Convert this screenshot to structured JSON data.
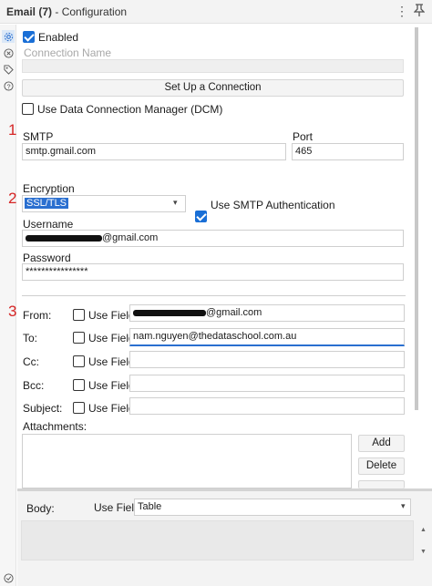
{
  "header": {
    "tool": "Email (7)",
    "title": "- Configuration",
    "more_icon": "kebab-icon",
    "pin_icon": "pin-icon"
  },
  "rail": {
    "icons": [
      "gear-icon",
      "connection-icon",
      "tag-icon",
      "help-icon"
    ]
  },
  "enabled": {
    "label": "Enabled",
    "checked": true
  },
  "connection_name": {
    "placeholder": "Connection Name",
    "value": ""
  },
  "setup_button": "Set Up a Connection",
  "dcm": {
    "label": "Use Data Connection Manager (DCM)",
    "checked": false
  },
  "annotations": {
    "n1": "1",
    "n2": "2",
    "n3": "3"
  },
  "smtp": {
    "label": "SMTP",
    "value": "smtp.gmail.com"
  },
  "port": {
    "label": "Port",
    "value": "465"
  },
  "encryption": {
    "label": "Encryption",
    "value": "SSL/TLS"
  },
  "smtp_auth": {
    "label": "Use SMTP Authentication",
    "checked": true
  },
  "username": {
    "label": "Username",
    "suffix": "@gmail.com"
  },
  "password": {
    "label": "Password",
    "value": "****************"
  },
  "recipients": {
    "use_field_label": "Use Field",
    "from": {
      "label": "From:",
      "suffix": "@gmail.com"
    },
    "to": {
      "label": "To:",
      "value": "nam.nguyen@thedataschool.com.au"
    },
    "cc": {
      "label": "Cc:",
      "value": ""
    },
    "bcc": {
      "label": "Bcc:",
      "value": ""
    },
    "subject": {
      "label": "Subject:",
      "value": ""
    }
  },
  "attachments": {
    "label": "Attachments:",
    "add": "Add",
    "delete": "Delete"
  },
  "body": {
    "label": "Body:",
    "use_field_label": "Use Field",
    "use_field_checked": true,
    "value": "Table"
  },
  "footer_icon": "check-circle-icon"
}
